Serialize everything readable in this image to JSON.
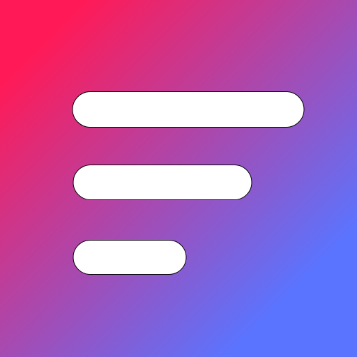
{
  "icon": {
    "name": "sort-filter-lines-icon",
    "colors": {
      "gradient_start": "#ff1a57",
      "gradient_end": "#5a74ff",
      "bar_fill": "#ffffff",
      "bar_stroke": "#000000"
    }
  }
}
